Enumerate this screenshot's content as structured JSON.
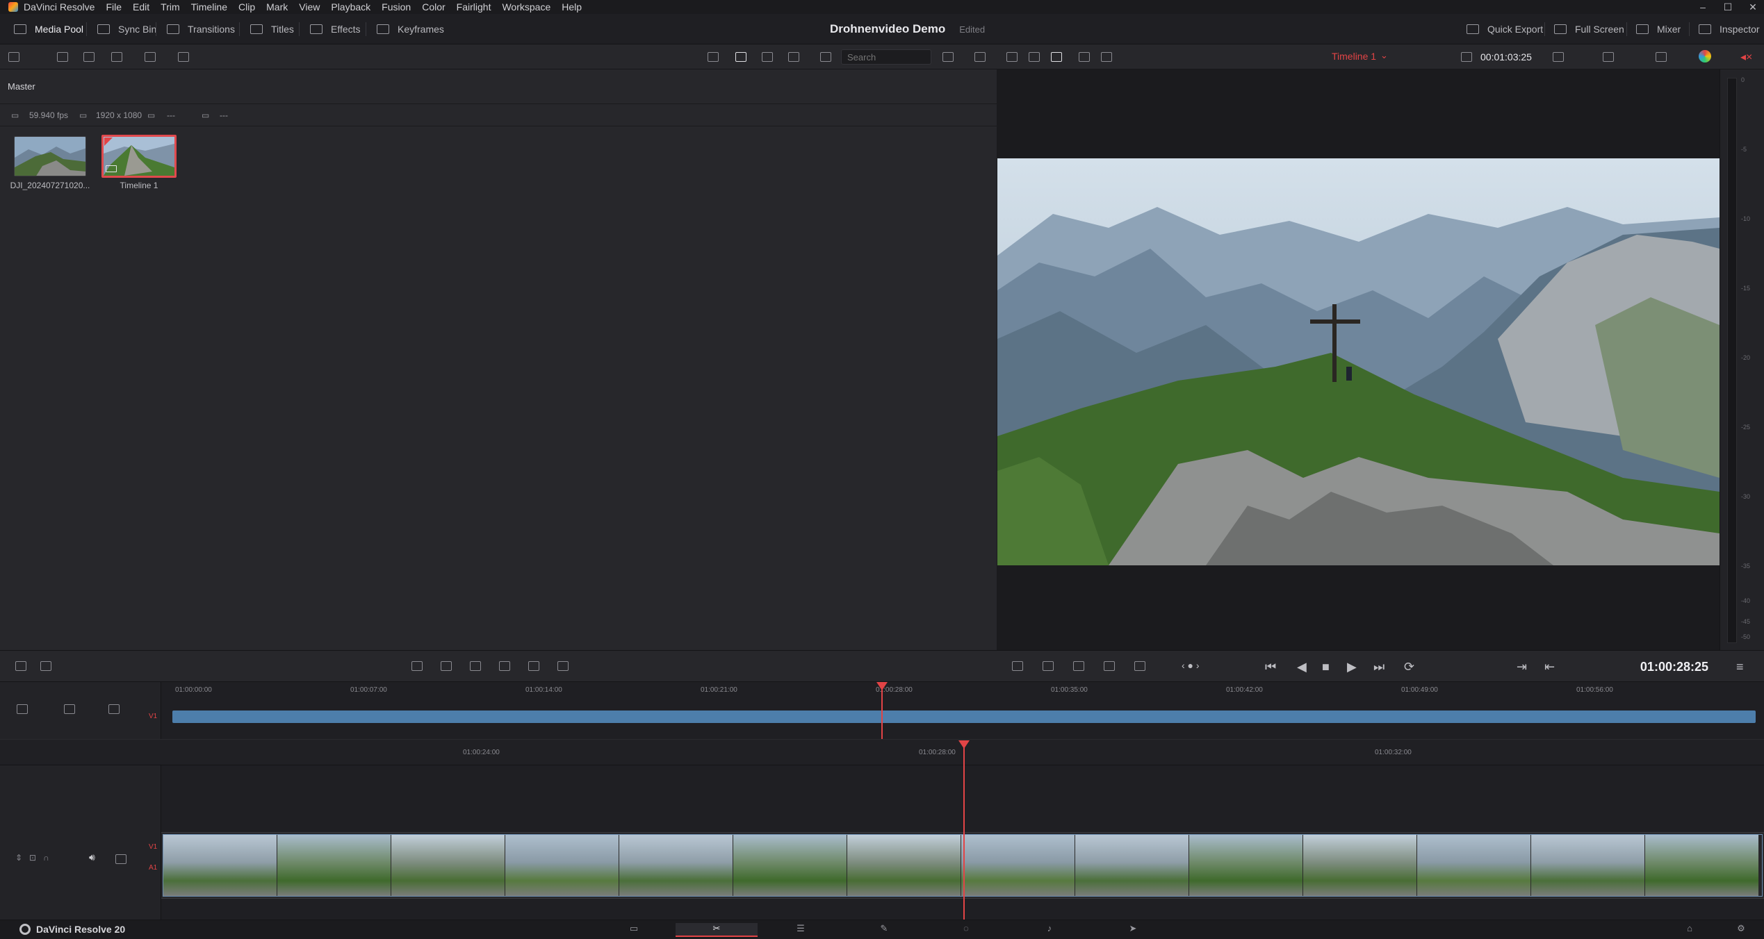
{
  "os_menu": {
    "app": "DaVinci Resolve",
    "items": [
      "File",
      "Edit",
      "Trim",
      "Timeline",
      "Clip",
      "Mark",
      "View",
      "Playback",
      "Fusion",
      "Color",
      "Fairlight",
      "Workspace",
      "Help"
    ]
  },
  "toolbar": {
    "media_pool": "Media Pool",
    "sync_bin": "Sync Bin",
    "transitions": "Transitions",
    "titles": "Titles",
    "effects": "Effects",
    "keyframes": "Keyframes",
    "project_title": "Drohnenvideo Demo",
    "project_status": "Edited",
    "quick_export": "Quick Export",
    "full_screen": "Full Screen",
    "mixer": "Mixer",
    "inspector": "Inspector"
  },
  "media_pool": {
    "search_placeholder": "Search",
    "bin": "Master",
    "fps": "59.940 fps",
    "resolution": "1920 x 1080",
    "meta_dash1": "---",
    "meta_dash2": "---",
    "clips": [
      {
        "label": "DJI_202407271020..."
      },
      {
        "label": "Timeline 1"
      }
    ]
  },
  "viewer": {
    "timeline_name": "Timeline 1",
    "duration_tc": "00:01:03:25",
    "current_tc": "01:00:28:25",
    "meter_ticks": [
      "0",
      "-5",
      "-10",
      "-15",
      "-20",
      "-25",
      "-30",
      "-35",
      "-40",
      "-45",
      "-50"
    ]
  },
  "timeline": {
    "mini_ruler": [
      "01:00:00:00",
      "01:00:07:00",
      "01:00:14:00",
      "01:00:21:00",
      "01:00:28:00",
      "01:00:35:00",
      "01:00:42:00",
      "01:00:49:00",
      "01:00:56:00"
    ],
    "big_ruler": [
      "01:00:24:00",
      "01:00:28:00",
      "01:00:32:00"
    ],
    "track_v1": "V1",
    "track_a1": "A1"
  },
  "pages": {
    "brand": "DaVinci Resolve 20",
    "active_index": 1
  },
  "colors": {
    "accent_red": "#e24446",
    "clip_blue": "#4d7eab"
  }
}
